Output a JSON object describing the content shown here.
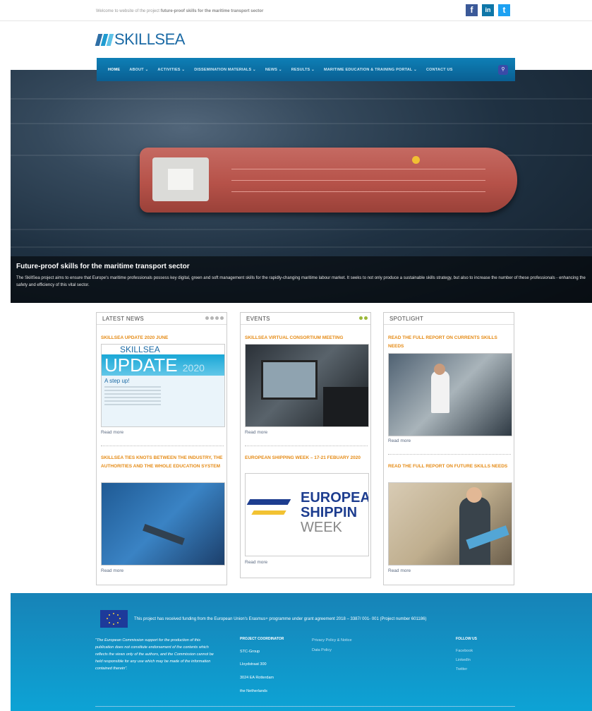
{
  "topbar": {
    "welcome_prefix": "Welcome to website of the project",
    "welcome_bold": "future-proof skills for the maritime transport sector",
    "social": {
      "facebook": "f",
      "linkedin": "in",
      "twitter": "t"
    }
  },
  "logo": {
    "text": "SKILLSEA"
  },
  "nav": {
    "items": [
      "HOME",
      "ABOUT",
      "ACTIVITIES",
      "DISSEMINATION MATERIALS",
      "NEWS",
      "RESULTS",
      "MARITIME EDUCATION & TRAINING PORTAL",
      "CONTACT US"
    ],
    "search_icon": "search-icon"
  },
  "hero": {
    "title": "Future-proof skills for the maritime transport sector",
    "text": "The SkillSea project aims to ensure that Europe's maritime professionals possess key digital, green and soft management skills for the rapidly-changing maritime labour market. It seeks to not only produce a sustainable skills strategy, but also to increase the number of these professionals - enhancing the safety and efficiency of this vital sector."
  },
  "columns": {
    "news": {
      "heading": "LATEST NEWS",
      "item1": {
        "title": "SKILLSEA UPDATE 2020 JUNE",
        "read_more": "Read more"
      },
      "item2": {
        "title": "SKILLSEA TIES KNOTS BETWEEN THE INDUSTRY, THE AUTHORITIES AND THE WHOLE EDUCATION SYSTEM",
        "read_more": "Read more"
      },
      "thumb1": {
        "brand": "SKILLSEA",
        "headline": "UPDATE",
        "year": "2020",
        "sub": "A step up!"
      }
    },
    "events": {
      "heading": "EVENTS",
      "item1": {
        "title": "SKILLSEA VIRTUAL CONSORTIUM MEETING",
        "read_more": "Read more"
      },
      "item2": {
        "title": "EUROPEAN SHIPPING WEEK – 17-21 FEBUARY 2020",
        "read_more": "Read more"
      },
      "thumb2": {
        "line1": "EUROPEA",
        "line2": "SHIPPIN",
        "line3": "WEEK"
      }
    },
    "spotlight": {
      "heading": "SPOTLIGHT",
      "item1": {
        "title": "READ THE FULL REPORT ON CURRENTS SKILLS NEEDS",
        "read_more": "Read more"
      },
      "item2": {
        "title": "READ THE FULL REPORT ON FUTURE SKILLS NEEDS",
        "read_more": "Read more"
      }
    }
  },
  "footer": {
    "funding": "This project has received funding from the European Union's Erasmus+ programme under grant agreement 2018 – 3387/ 001- 001 (Project number 601186)",
    "disclaimer": "\"The European Commission support for the production of this publication does not constitute endorsement of the contents which reflects the views only of the authors, and the Commission cannot be held responsible for any use which may be made of the information contained therein\".",
    "coordinator_heading": "PROJECT COORDINATOR",
    "coordinator_lines": [
      "STC-Group",
      "Lloydstraat 300",
      "3024 EA Rotterdam",
      "the Netherlands"
    ],
    "links": [
      "Privacy Policy & Notice",
      "Data Policy"
    ],
    "follow_heading": "FOLLOW US",
    "follow_links": [
      "Facebook",
      "LinkedIn",
      "Twitter"
    ]
  }
}
